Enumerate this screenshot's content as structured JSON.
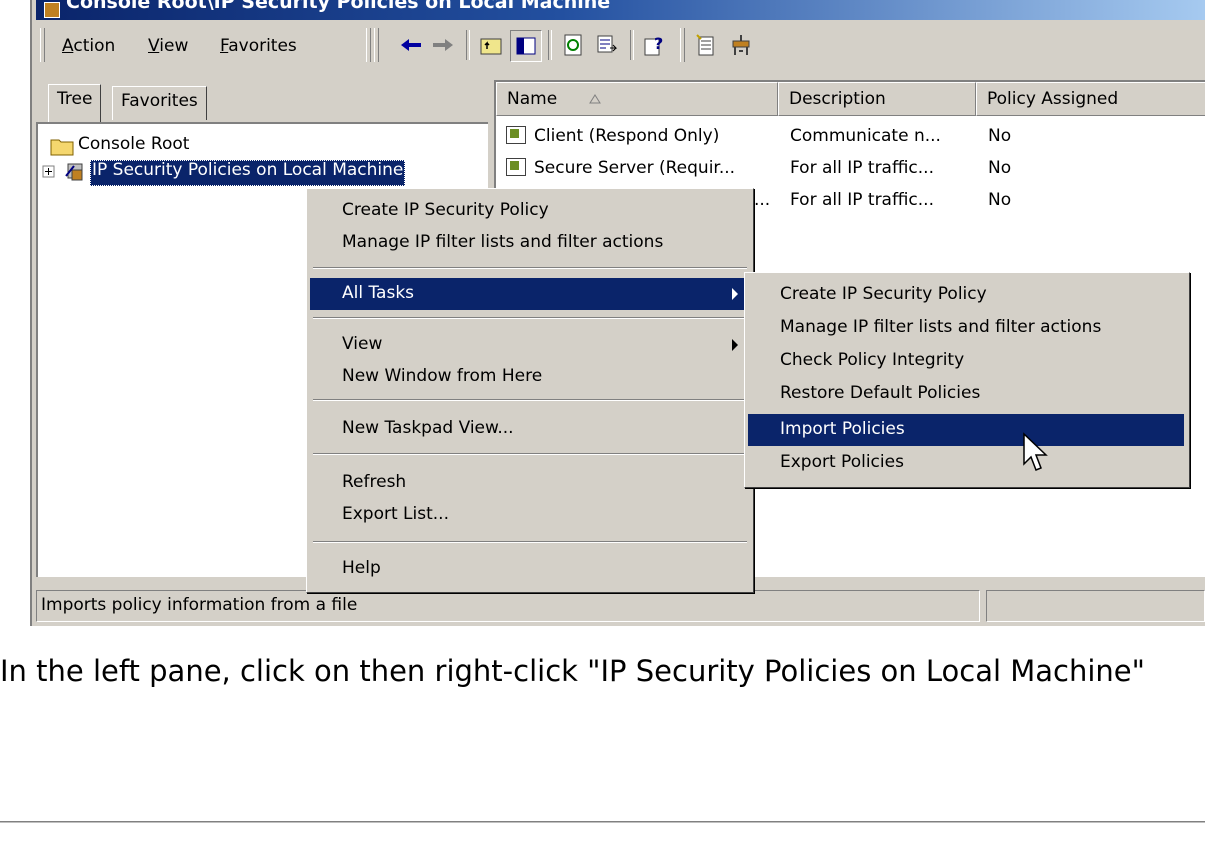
{
  "window": {
    "title": "Console Root\\IP Security Policies on Local Machine"
  },
  "menubar": {
    "items": [
      "Action",
      "View",
      "Favorites"
    ],
    "underline": [
      "A",
      "V",
      "F"
    ]
  },
  "toolbar": {
    "icons": [
      "back-arrow-icon",
      "forward-arrow-icon",
      "up-folder-icon",
      "show-hide-tree-icon",
      "refresh-icon",
      "export-list-icon",
      "help-icon",
      "create-policy-icon",
      "manage-filters-icon"
    ]
  },
  "tabs": {
    "tree": "Tree",
    "favorites": "Favorites"
  },
  "tree": {
    "root": "Console Root",
    "child": "IP Security Policies on Local Machine"
  },
  "list": {
    "columns": [
      "Name",
      "Description",
      "Policy Assigned"
    ],
    "rows": [
      {
        "name": "Client (Respond Only)",
        "description": "Communicate n...",
        "assigned": "No"
      },
      {
        "name": "Secure Server (Requir...",
        "description": "For all IP traffic...",
        "assigned": "No"
      },
      {
        "name": "...",
        "description": "For all IP traffic...",
        "assigned": "No"
      }
    ]
  },
  "context_menu": {
    "items": [
      "Create IP Security Policy",
      "Manage IP filter lists and filter actions",
      "All Tasks",
      "View",
      "New Window from Here",
      "New Taskpad View...",
      "Refresh",
      "Export List...",
      "Help"
    ]
  },
  "submenu": {
    "items": [
      "Create IP Security Policy",
      "Manage IP filter lists and filter actions",
      "Check Policy Integrity",
      "Restore Default Policies",
      "Import Policies",
      "Export Policies"
    ],
    "selected": "Import Policies"
  },
  "status": {
    "text": "Imports policy information from a file"
  },
  "caption": "In the left pane, click on then right-click \"IP Security Policies on Local Machine\"",
  "colors": {
    "selection": "#0a246a",
    "face": "#d4d0c8",
    "title_start": "#0a246a",
    "title_end": "#a6caf0"
  }
}
